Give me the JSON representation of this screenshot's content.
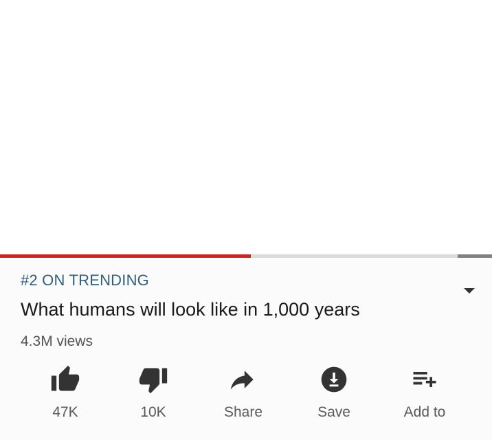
{
  "video": {
    "progress_fraction": 0.51
  },
  "info": {
    "trending": "#2 ON TRENDING",
    "title": "What humans will look like in 1,000 years",
    "views": "4.3M views",
    "expand_icon": "chevron-down-icon"
  },
  "actions": [
    {
      "label": "47K",
      "icon": "thumbs-up-icon"
    },
    {
      "label": "10K",
      "icon": "thumbs-down-icon"
    },
    {
      "label": "Share",
      "icon": "share-icon"
    },
    {
      "label": "Save",
      "icon": "download-icon"
    },
    {
      "label": "Add to",
      "icon": "playlist-add-icon"
    }
  ],
  "colors": {
    "progress": "#d02424",
    "trending": "#2f5f7a",
    "icon": "#333333"
  }
}
